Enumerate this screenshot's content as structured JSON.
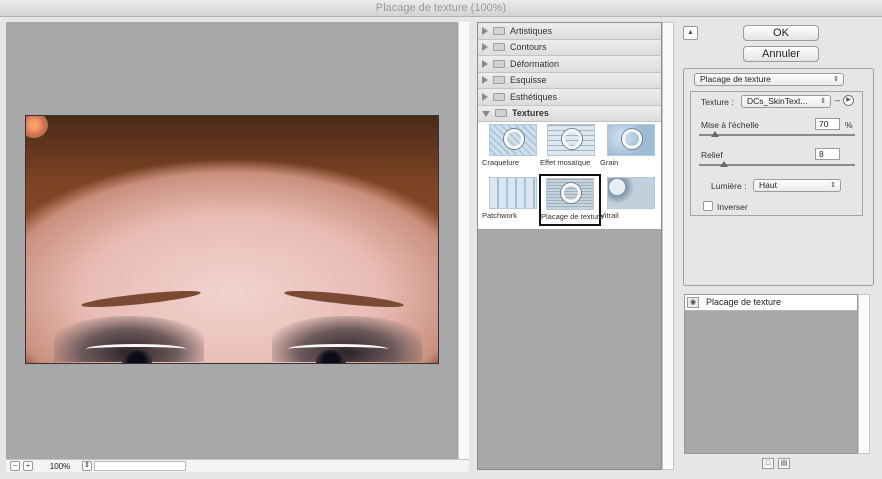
{
  "window": {
    "title": "Placage de texture (100%)"
  },
  "preview": {
    "zoom": "100%",
    "zoom_out": "−",
    "zoom_in": "+",
    "zoom_arrow": "⇕"
  },
  "gallery": {
    "categories": [
      {
        "label": "Artistiques",
        "open": false
      },
      {
        "label": "Contours",
        "open": false
      },
      {
        "label": "Déformation",
        "open": false
      },
      {
        "label": "Esquisse",
        "open": false
      },
      {
        "label": "Esthétiques",
        "open": false
      },
      {
        "label": "Textures",
        "open": true
      }
    ],
    "textures": [
      {
        "label": "Craquelure",
        "icon": "craquelure-thumbnail"
      },
      {
        "label": "Effet mosaïque",
        "icon": "mosaic-thumbnail"
      },
      {
        "label": "Grain",
        "icon": "grain-thumbnail"
      },
      {
        "label": "Patchwork",
        "icon": "patchwork-thumbnail"
      },
      {
        "label": "Placage de texture",
        "icon": "texturizer-thumbnail",
        "selected": true
      },
      {
        "label": "Vitrail",
        "icon": "stained-glass-thumbnail"
      }
    ]
  },
  "buttons": {
    "ok": "OK",
    "cancel": "Annuler",
    "collapse": "▲"
  },
  "settings": {
    "filter_select": "Placage de texture",
    "texture_label": "Texture :",
    "texture_value": "DCs_SkinText...",
    "scale_label": "Mise à l'échelle",
    "scale_value": "70",
    "scale_unit": "%",
    "scale_fraction": 0.1,
    "relief_label": "Relief",
    "relief_value": "8",
    "relief_fraction": 0.16,
    "light_label": "Lumière :",
    "light_value": "Haut",
    "invert_label": "Inverser",
    "invert_checked": false
  },
  "layers": {
    "items": [
      {
        "name": "Placage de texture",
        "visible": true
      }
    ]
  }
}
